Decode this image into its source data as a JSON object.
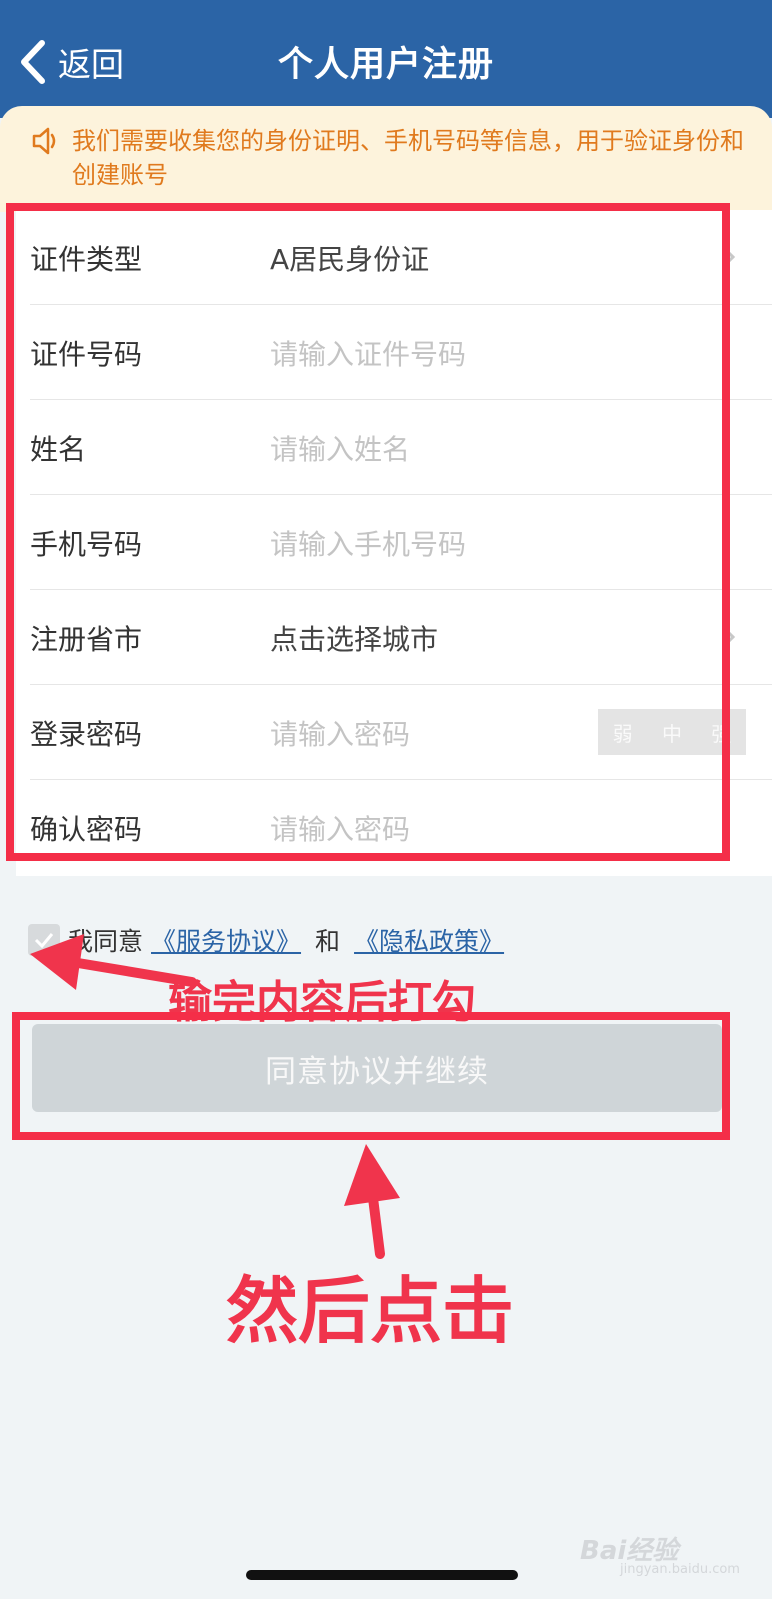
{
  "header": {
    "back_label": "返回",
    "title": "个人用户注册",
    "bg_color": "#2b64a6"
  },
  "notice": {
    "icon": "speaker-icon",
    "text": "我们需要收集您的身份证明、手机号码等信息，用于验证身份和创建账号"
  },
  "form": {
    "rows": [
      {
        "label": "证件类型",
        "value": "A居民身份证",
        "has_chevron": true
      },
      {
        "label": "证件号码",
        "placeholder": "请输入证件号码"
      },
      {
        "label": "姓名",
        "placeholder": "请输入姓名"
      },
      {
        "label": "手机号码",
        "placeholder": "请输入手机号码"
      },
      {
        "label": "注册省市",
        "value": "点击选择城市",
        "has_chevron": true
      },
      {
        "label": "登录密码",
        "placeholder": "请输入密码",
        "strength": [
          "弱",
          "中",
          "强"
        ]
      },
      {
        "label": "确认密码",
        "placeholder": "请输入密码"
      }
    ]
  },
  "agreement": {
    "prefix": "我同意",
    "service_link": "《服务协议》",
    "conjunction": "和",
    "privacy_link": "《隐私政策》",
    "checked": true
  },
  "submit_label": "同意协议并继续",
  "annotations": {
    "check_hint": "输完内容后打勾",
    "click_hint": "然后点击",
    "color": "#f0344c"
  },
  "watermark": {
    "logo": "Bai经验",
    "url": "jingyan.baidu.com"
  }
}
